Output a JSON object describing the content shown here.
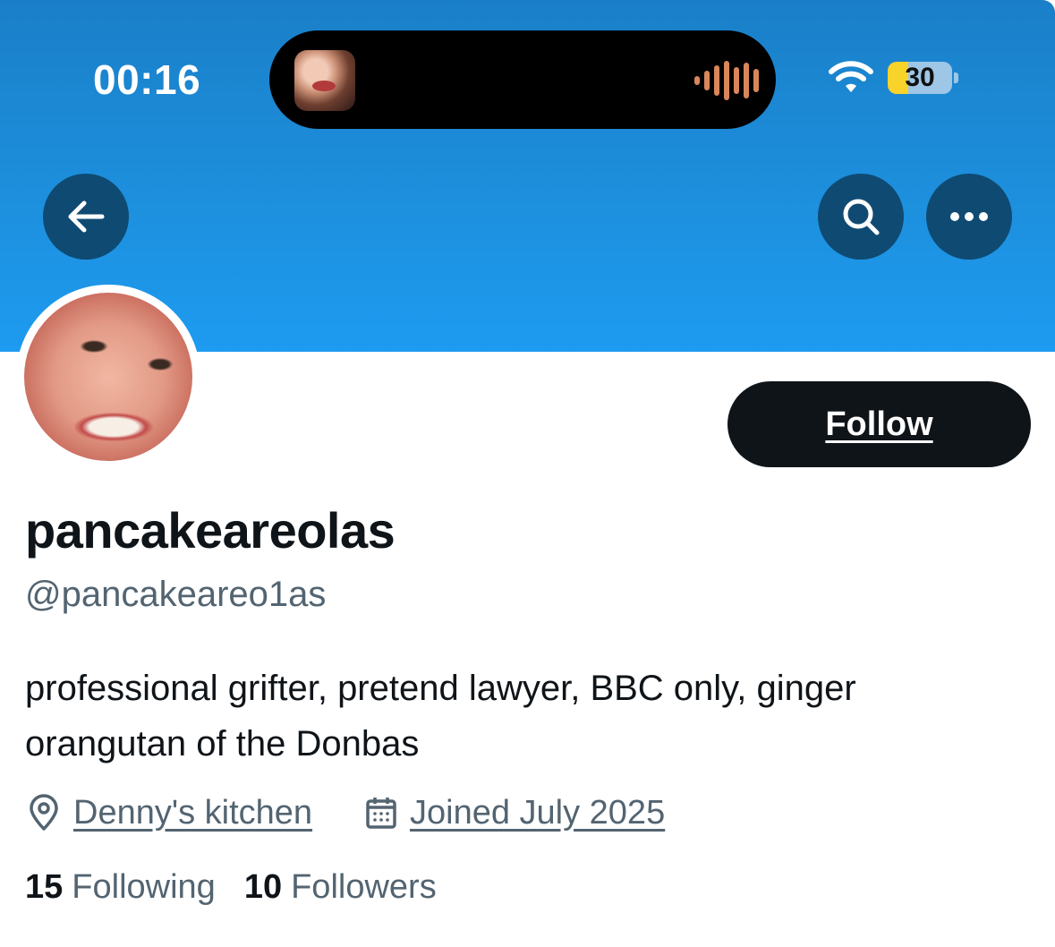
{
  "status_bar": {
    "time": "00:16",
    "battery": "30"
  },
  "profile": {
    "display_name": "pancakeareolas",
    "handle": "@pancakeareo1as",
    "bio": "professional grifter, pretend lawyer, BBC only, ginger orangutan of the Donbas",
    "location": "Denny's kitchen",
    "joined": "Joined July 2025",
    "following_count": "15",
    "following_label": "Following",
    "followers_count": "10",
    "followers_label": "Followers"
  },
  "actions": {
    "follow_label": "Follow"
  },
  "icons": {
    "back": "arrow-left-icon",
    "search": "search-icon",
    "more": "more-horizontal-icon",
    "location": "location-pin-icon",
    "calendar": "calendar-icon",
    "wifi": "wifi-icon",
    "waveform": "audio-waveform-icon"
  },
  "colors": {
    "banner": "#1d9bf0",
    "button_bg": "#0f4a73",
    "follow_bg": "#0f1419",
    "secondary_text": "#536471",
    "battery_low": "#f8d32a"
  }
}
